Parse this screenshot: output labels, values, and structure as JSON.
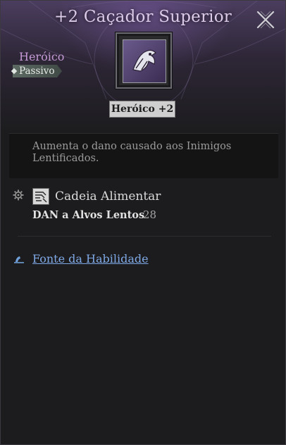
{
  "tooltip": {
    "title": "+2 Caçador Superior",
    "rarity": "Heróico",
    "type_tag": "Passivo",
    "level_badge": "Heróico +2",
    "description": "Aumenta o dano causado aos Inimigos Lentificados.",
    "effect": {
      "name": "Cadeia Alimentar",
      "stat_label": "DAN a Alvos Lentos",
      "stat_value": "28"
    },
    "source_link": "Fonte da Habilidade"
  },
  "colors": {
    "title": "#dccbe8",
    "rarity": "#c59ad6",
    "link": "#7fa9e6",
    "panel_bg": "#1c1c1e"
  },
  "icons": [
    "close-icon",
    "skill-emblem-icon",
    "gear-icon",
    "effect-icon",
    "source-icon"
  ]
}
